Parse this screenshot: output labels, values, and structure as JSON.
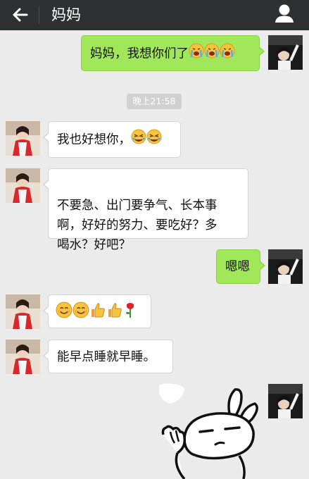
{
  "header": {
    "title": "妈妈",
    "back_icon": "back-arrow-icon",
    "profile_icon": "person-icon",
    "bg_color": "#2e3132"
  },
  "colors": {
    "background": "#ebebeb",
    "incoming_bubble": "#ffffff",
    "outgoing_bubble": "#a0e75a",
    "timestamp_bg": "#d1d1d1"
  },
  "messages": [
    {
      "from": "me",
      "text": "妈妈，我想你们了",
      "emojis": [
        "crying-face-icon",
        "crying-face-icon",
        "crying-face-icon"
      ]
    },
    {
      "type": "timestamp",
      "text": "晚上21:58"
    },
    {
      "from": "mom",
      "text": "我也好想你，",
      "emojis": [
        "sobbing-face-icon",
        "sobbing-face-icon"
      ]
    },
    {
      "from": "mom",
      "text": "不要急、出门要争气、长本事\n啊，好好的努力、要吃好？多\n喝水？好吧？"
    },
    {
      "from": "me",
      "text": "嗯嗯"
    },
    {
      "from": "mom",
      "text": "",
      "emojis": [
        "smiling-face-icon",
        "smiling-face-icon",
        "thumbs-up-icon",
        "thumbs-up-icon",
        "rose-icon"
      ]
    },
    {
      "from": "mom",
      "text": "能早点睡就早睡。"
    },
    {
      "from": "me",
      "type": "sticker",
      "sticker": "rabbit-sticker"
    }
  ]
}
